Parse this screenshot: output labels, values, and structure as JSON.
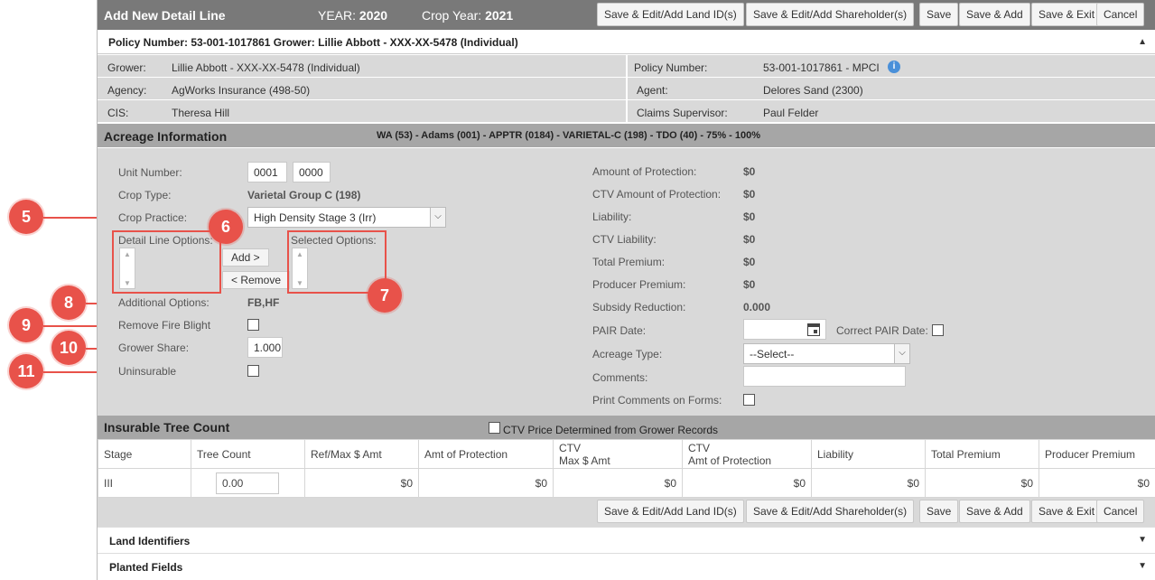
{
  "title": "Add New Detail Line",
  "year_label": "YEAR:",
  "year_value": "2020",
  "crop_year_label": "Crop Year:",
  "crop_year_value": "2021",
  "toolbar": {
    "land_id": "Save & Edit/Add Land ID(s)",
    "shareholder": "Save & Edit/Add Shareholder(s)",
    "save": "Save",
    "save_add": "Save & Add",
    "save_exit": "Save & Exit",
    "cancel": "Cancel"
  },
  "policy_bar": "Policy Number: 53-001-1017861 Grower: Lillie Abbott - XXX-XX-5478 (Individual)",
  "info": {
    "grower_label": "Grower:",
    "grower_value": "Lillie Abbott - XXX-XX-5478 (Individual)",
    "policy_label": "Policy Number:",
    "policy_value": "53-001-1017861 - MPCI",
    "agency_label": "Agency:",
    "agency_value": "AgWorks Insurance (498-50)",
    "agent_label": "Agent:",
    "agent_value": "Delores Sand (2300)",
    "cis_label": "CIS:",
    "cis_value": "Theresa Hill",
    "claims_label": "Claims Supervisor:",
    "claims_value": "Paul Felder"
  },
  "acreage": {
    "heading": "Acreage Information",
    "summary": "WA (53) - Adams (001) - APPTR (0184) - VARIETAL-C (198) - TDO (40) - 75% - 100%",
    "unit_label": "Unit Number:",
    "unit_1": "0001",
    "unit_2": "0000",
    "crop_type_label": "Crop Type:",
    "crop_type_value": "Varietal Group C (198)",
    "crop_practice_label": "Crop Practice:",
    "crop_practice_value": "High Density Stage 3 (Irr)",
    "detail_options_label": "Detail Line Options:",
    "selected_options_label": "Selected Options:",
    "add_label": "Add >",
    "remove_label": "< Remove",
    "additional_label": "Additional Options:",
    "additional_value": "FB,HF",
    "fire_blight_label": "Remove Fire Blight",
    "grower_share_label": "Grower Share:",
    "grower_share_value": "1.000",
    "uninsurable_label": "Uninsurable",
    "amount_label": "Amount of Protection:",
    "amount_value": "$0",
    "ctv_amount_label": "CTV Amount of Protection:",
    "ctv_amount_value": "$0",
    "liability_label": "Liability:",
    "liability_value": "$0",
    "ctv_liability_label": "CTV Liability:",
    "ctv_liability_value": "$0",
    "total_premium_label": "Total Premium:",
    "total_premium_value": "$0",
    "producer_premium_label": "Producer Premium:",
    "producer_premium_value": "$0",
    "subsidy_label": "Subsidy Reduction:",
    "subsidy_value": "0.000",
    "pair_label": "PAIR Date:",
    "correct_pair_label": "Correct PAIR Date:",
    "acreage_type_label": "Acreage Type:",
    "acreage_type_value": "--Select--",
    "comments_label": "Comments:",
    "print_comments_label": "Print Comments on Forms:"
  },
  "tree_count": {
    "heading": "Insurable Tree Count",
    "ctv_price_label": "CTV Price Determined from Grower Records",
    "headers": [
      "Stage",
      "Tree Count",
      "Ref/Max $ Amt",
      "Amt of Protection",
      "CTV",
      "Max $ Amt",
      "CTV",
      "Amt of Protection",
      "Liability",
      "Total Premium",
      "Producer Premium"
    ],
    "row": {
      "stage": "III",
      "tree_count": "0.00",
      "ref_max": "$0",
      "amt_protection": "$0",
      "ctv_max": "$0",
      "ctv_amt": "$0",
      "liability": "$0",
      "total_premium": "$0",
      "producer_premium": "$0"
    }
  },
  "accordions": {
    "land": "Land Identifiers",
    "planted": "Planted Fields"
  },
  "callouts": [
    "5",
    "6",
    "7",
    "8",
    "9",
    "10",
    "11"
  ],
  "colors": {
    "callout": "#e8524a",
    "header": "#797979",
    "section": "#a6a6a6",
    "panel": "#d9d9d9"
  }
}
